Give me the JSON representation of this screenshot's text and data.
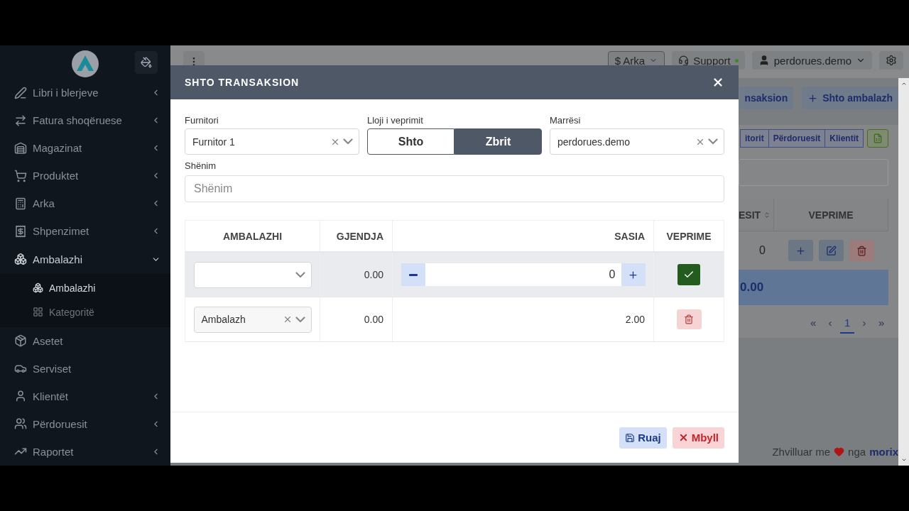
{
  "sidebar": {
    "items": [
      {
        "kind": "group",
        "label": "Libri i blerjeve",
        "expanded": false,
        "selected": false
      },
      {
        "kind": "group",
        "label": "Fatura shoqëruese",
        "expanded": false,
        "selected": false
      },
      {
        "kind": "group",
        "label": "Magazinat",
        "expanded": false,
        "selected": false
      },
      {
        "kind": "group",
        "label": "Produktet",
        "expanded": false,
        "selected": false
      },
      {
        "kind": "group",
        "label": "Arka",
        "expanded": false,
        "selected": false
      },
      {
        "kind": "group",
        "label": "Shpenzimet",
        "expanded": false,
        "selected": false
      },
      {
        "kind": "group",
        "label": "Ambalazhi",
        "expanded": true,
        "selected": false,
        "children": [
          {
            "label": "Ambalazhi",
            "selected": true
          },
          {
            "label": "Kategoritë",
            "selected": false
          }
        ]
      },
      {
        "kind": "link",
        "label": "Asetet",
        "selected": false
      },
      {
        "kind": "link",
        "label": "Serviset",
        "selected": false
      },
      {
        "kind": "group",
        "label": "Klientët",
        "expanded": false,
        "selected": false
      },
      {
        "kind": "group",
        "label": "Përdoruesit",
        "expanded": false,
        "selected": false
      },
      {
        "kind": "group",
        "label": "Raportet",
        "expanded": false,
        "selected": false
      }
    ]
  },
  "topbar": {
    "cash_button": "$ Arka",
    "support": "Support",
    "user": "perdorues.demo"
  },
  "page": {
    "action_buttons": [
      "nsaksion",
      "Shto ambalazh"
    ],
    "filters": [
      "itorit",
      "Përdoruesit",
      "Klientit"
    ],
    "table": {
      "columns": [
        "ESIT",
        "VEPRIME"
      ],
      "row": "0",
      "total": "0.00"
    },
    "pagination": [
      {
        "label": "«",
        "selected": false
      },
      {
        "label": "‹",
        "selected": false
      },
      {
        "label": "1",
        "selected": true
      },
      {
        "label": "›",
        "selected": false
      },
      {
        "label": "»",
        "selected": false
      }
    ]
  },
  "footer": {
    "text": "Zhvilluar me",
    "text2": "nga",
    "link": "morix"
  },
  "modal": {
    "title": "SHTO TRANSAKSION",
    "supplier": {
      "label": "Furnitori",
      "value": "Furnitor 1"
    },
    "operation": {
      "label": "Lloji i veprimit",
      "options": [
        {
          "label": "Shto",
          "selected": false
        },
        {
          "label": "Zbrit",
          "selected": true
        }
      ]
    },
    "receiver": {
      "label": "Marrësi",
      "value": "perdorues.demo"
    },
    "note": {
      "label": "Shënim",
      "placeholder": "Shënim"
    },
    "table": {
      "columns": [
        "AMBALAZHI",
        "GJENDJA",
        "SASIA",
        "VEPRIME"
      ],
      "rows": [
        {
          "kind": "input",
          "package": "",
          "stock": "0.00",
          "quantity": "0"
        },
        {
          "kind": "item",
          "package": "Ambalazh",
          "stock": "0.00",
          "quantity": "2.00"
        }
      ]
    },
    "buttons": [
      {
        "kind": "save",
        "label": "Ruaj"
      },
      {
        "kind": "close",
        "label": "Mbyll"
      }
    ]
  }
}
